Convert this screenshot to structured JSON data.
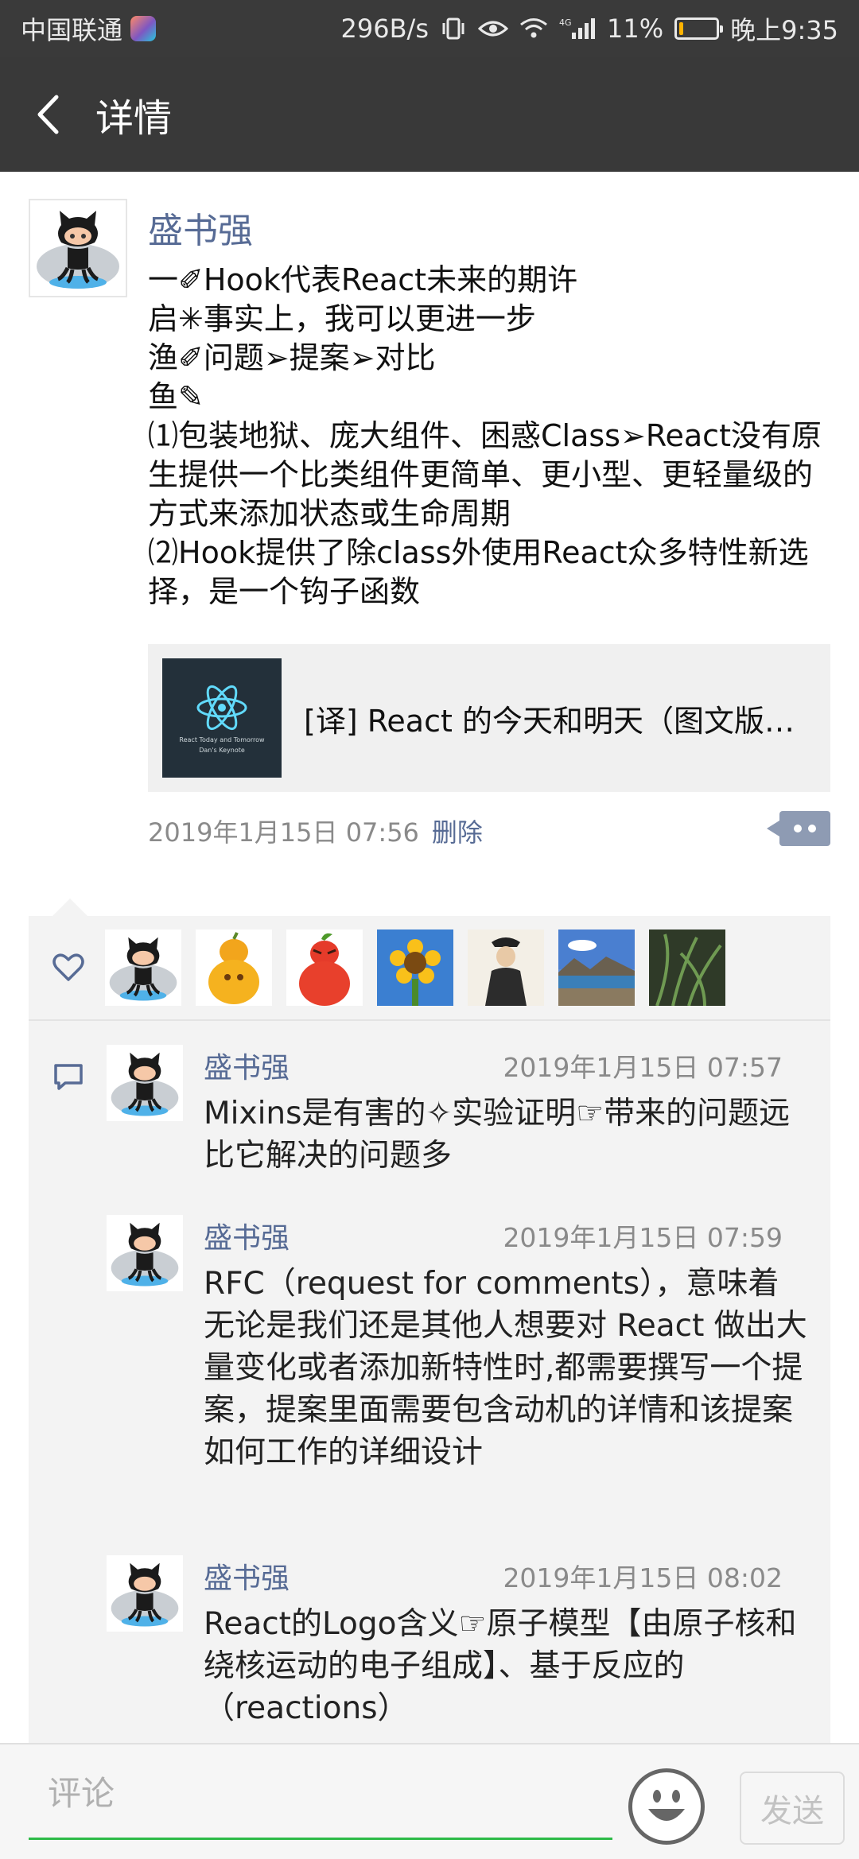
{
  "status_bar": {
    "carrier": "中国联通",
    "net_speed": "296B/s",
    "network": "4G",
    "battery": "11%",
    "battery_level": 0.11,
    "time": "晚上9:35"
  },
  "header": {
    "title": "详情"
  },
  "post": {
    "author": "盛书强",
    "content_lines": [
      "一✐Hook代表React未来的期许",
      "启✳事实上，我可以更进一步",
      "渔✐问题➢提案➢对比",
      "鱼✎",
      "⑴包装地狱、庞大组件、困惑Class➢React没有原生提供一个比类组件更简单、更小型、更轻量级的方式来添加状态或生命周期",
      "⑵Hook提供了除class外使用React众多特性新选择，是一个钩子函数"
    ],
    "link_card": {
      "title": "[译] React 的今天和明天（图文版…",
      "thumb_caption_1": "React Today and Tomorrow",
      "thumb_caption_2": "Dan's Keynote"
    },
    "timestamp": "2019年1月15日 07:56",
    "delete_label": "删除"
  },
  "likes": {
    "avatars": [
      "github-octocat",
      "gourd-orange",
      "gourd-red",
      "sunflower",
      "ink-figure",
      "landscape-lake",
      "plant-leaves"
    ]
  },
  "comments": [
    {
      "author": "盛书强",
      "time": "2019年1月15日 07:57",
      "text": "Mixins是有害的✧实验证明☞带来的问题远比它解决的问题多"
    },
    {
      "author": "盛书强",
      "time": "2019年1月15日 07:59",
      "text": "RFC（request for comments），意味着无论是我们还是其他人想要对 React 做出大量变化或者添加新特性时,都需要撰写一个提案，提案里面需要包含动机的详情和该提案如何工作的详细设计"
    },
    {
      "author": "盛书强",
      "time": "2019年1月15日 08:02",
      "text": "React的Logo含义☞原子模型【由原子核和绕核运动的电子组成】、基于反应的（reactions）"
    }
  ],
  "input": {
    "placeholder": "评论",
    "send_label": "发送"
  }
}
